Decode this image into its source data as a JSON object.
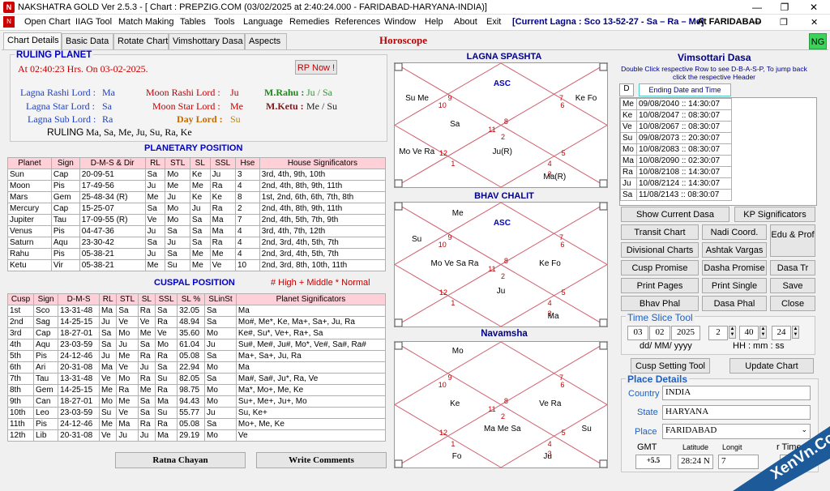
{
  "window": {
    "title": "NAKSHATRA GOLD Ver 2.5.3 - [ Chart : PREPZIG.COM (03/02/2025 at 2:40:24.000 - FARIDABAD-HARYANA-INDIA)]",
    "icon": "NG"
  },
  "menu": {
    "items": [
      "Open Chart",
      "IIAG Tool",
      "Match Making",
      "Tables",
      "Tools",
      "Language",
      "Remedies",
      "References",
      "Window",
      "Help",
      "About",
      "Exit"
    ],
    "lagna_info": "[Current Lagna : Sco 13-52-27 - Sa – Ra – Me]",
    "location_info": "At FARIDABAD"
  },
  "tabs": [
    "Chart Details",
    "Basic Data",
    "Rotate Chart",
    "Vimshottary Dasa",
    "Aspects"
  ],
  "header": {
    "horoscope": "Horoscope",
    "ng_badge": "NG"
  },
  "ruling": {
    "title": "RULING PLANET",
    "time": "At 02:40:23 Hrs. On 03-02-2025.",
    "rp_button": "RP Now !",
    "lagna_rashi_label": "Lagna Rashi Lord :",
    "lagna_rashi_val": "Ma",
    "lagna_star_label": "Lagna Star Lord :",
    "lagna_star_val": "Sa",
    "lagna_sub_label": "Lagna Sub Lord :",
    "lagna_sub_val": "Ra",
    "moon_rashi_label": "Moon Rashi Lord :",
    "moon_rashi_val": "Ju",
    "moon_star_label": "Moon Star Lord :",
    "moon_star_val": "Me",
    "day_lord_label": "Day Lord :",
    "day_lord_val": "Su",
    "mrahu_label": "M.Rahu :",
    "mrahu_val": "Ju / Sa",
    "mketu_label": "M.Ketu :",
    "mketu_val": "Me / Su",
    "ruling_label": "RULING",
    "ruling_val": "Ma, Sa, Me, Ju, Su, Ra, Ke"
  },
  "planetary": {
    "title": "PLANETARY POSITION",
    "headers": [
      "Planet",
      "Sign",
      "D-M-S & Dir",
      "RL",
      "STL",
      "SL",
      "SSL",
      "Hse",
      "House Significators"
    ],
    "rows": [
      [
        "Sun",
        "Cap",
        "20-09-51",
        "Sa",
        "Mo",
        "Ke",
        "Ju",
        "3",
        "3rd, 4th, 9th, 10th"
      ],
      [
        "Moon",
        "Pis",
        "17-49-56",
        "Ju",
        "Me",
        "Me",
        "Ra",
        "4",
        "2nd, 4th, 8th, 9th, 11th"
      ],
      [
        "Mars",
        "Gem",
        "25-48-34  (R)",
        "Me",
        "Ju",
        "Ke",
        "Ke",
        "8",
        "1st, 2nd, 6th, 6th, 7th, 8th"
      ],
      [
        "Mercury",
        "Cap",
        "15-25-07",
        "Sa",
        "Mo",
        "Ju",
        "Ra",
        "2",
        "2nd, 4th, 8th, 9th, 11th"
      ],
      [
        "Jupiter",
        "Tau",
        "17-09-55  (R)",
        "Ve",
        "Mo",
        "Sa",
        "Ma",
        "7",
        "2nd, 4th, 5th, 7th, 9th"
      ],
      [
        "Venus",
        "Pis",
        "04-47-36",
        "Ju",
        "Sa",
        "Sa",
        "Ma",
        "4",
        "3rd, 4th, 7th, 12th"
      ],
      [
        "Saturn",
        "Aqu",
        "23-30-42",
        "Sa",
        "Ju",
        "Sa",
        "Ra",
        "4",
        "2nd, 3rd, 4th, 5th, 7th"
      ],
      [
        "Rahu",
        "Pis",
        "05-38-21",
        "Ju",
        "Sa",
        "Me",
        "Me",
        "4",
        "2nd, 3rd, 4th, 5th, 7th"
      ],
      [
        "Ketu",
        "Vir",
        "05-38-21",
        "Me",
        "Su",
        "Me",
        "Ve",
        "10",
        "2nd, 3rd, 8th, 10th, 11th"
      ]
    ]
  },
  "cuspal": {
    "title": "CUSPAL POSITION",
    "legend": "# High + Middle * Normal",
    "headers": [
      "Cusp",
      "Sign",
      "D-M-S",
      "RL",
      "STL",
      "SL",
      "SSL",
      "SL %",
      "SLinSt",
      "Planet Significators"
    ],
    "rows": [
      [
        "1st",
        "Sco",
        "13-31-48",
        "Ma",
        "Sa",
        "Ra",
        "Sa",
        "32.05",
        "Sa",
        "Ma"
      ],
      [
        "2nd",
        "Sag",
        "14-25-15",
        "Ju",
        "Ve",
        "Ve",
        "Ra",
        "48.94",
        "Sa",
        "Mo#, Me*, Ke, Ma+, Sa+, Ju, Ra"
      ],
      [
        "3rd",
        "Cap",
        "18-27-01",
        "Sa",
        "Mo",
        "Me",
        "Ve",
        "35.60",
        "Mo",
        "Ke#, Su*, Ve+, Ra+, Sa"
      ],
      [
        "4th",
        "Aqu",
        "23-03-59",
        "Sa",
        "Ju",
        "Sa",
        "Mo",
        "61.04",
        "Ju",
        "Su#, Me#, Ju#, Mo*, Ve#, Sa#, Ra#"
      ],
      [
        "5th",
        "Pis",
        "24-12-46",
        "Ju",
        "Me",
        "Ra",
        "Ra",
        "05.08",
        "Sa",
        "Ma+, Sa+, Ju, Ra"
      ],
      [
        "6th",
        "Ari",
        "20-31-08",
        "Ma",
        "Ve",
        "Ju",
        "Sa",
        "22.94",
        "Mo",
        "Ma"
      ],
      [
        "7th",
        "Tau",
        "13-31-48",
        "Ve",
        "Mo",
        "Ra",
        "Su",
        "82.05",
        "Sa",
        "Ma#, Sa#, Ju*, Ra, Ve"
      ],
      [
        "8th",
        "Gem",
        "14-25-15",
        "Me",
        "Ra",
        "Me",
        "Ra",
        "98.75",
        "Mo",
        "Ma*, Mo+, Me, Ke"
      ],
      [
        "9th",
        "Can",
        "18-27-01",
        "Mo",
        "Me",
        "Sa",
        "Ma",
        "94.43",
        "Mo",
        "Su+, Me+, Ju+, Mo"
      ],
      [
        "10th",
        "Leo",
        "23-03-59",
        "Su",
        "Ve",
        "Sa",
        "Su",
        "55.77",
        "Ju",
        "Su, Ke+"
      ],
      [
        "11th",
        "Pis",
        "24-12-46",
        "Me",
        "Ma",
        "Ra",
        "Ra",
        "05.08",
        "Sa",
        "Mo+, Me, Ke"
      ],
      [
        "12th",
        "Lib",
        "20-31-08",
        "Ve",
        "Ju",
        "Ju",
        "Ma",
        "29.19",
        "Mo",
        "Ve"
      ]
    ]
  },
  "bottom_buttons": {
    "ratna": "Ratna Chayan",
    "write": "Write Comments"
  },
  "charts": {
    "lagna": {
      "title": "LAGNA SPASHTA",
      "asc": "ASC",
      "numbers": [
        "9",
        "10",
        "8",
        "11",
        "2",
        "12",
        "1",
        "7",
        "6",
        "5",
        "4",
        "3"
      ],
      "texts": [
        "Su Me",
        "Sa",
        "Ke Fo",
        "Mo Ve Ra",
        "Ju(R)",
        "Ma(R)"
      ]
    },
    "bhav": {
      "title": "BHAV CHALIT",
      "asc": "ASC",
      "numbers": [
        "9",
        "10",
        "8",
        "11",
        "2",
        "12",
        "1",
        "7",
        "6",
        "5",
        "4",
        "3"
      ],
      "texts": [
        "Me",
        "Su",
        "Mo Ve Sa Ra",
        "Ke Fo",
        "Ju",
        "Ma"
      ]
    },
    "navamsha": {
      "title": "Navamsha",
      "numbers": [
        "9",
        "10",
        "8",
        "11",
        "2",
        "12",
        "1",
        "7",
        "6",
        "5",
        "4",
        "3"
      ],
      "texts": [
        "Mo",
        "Ke",
        "Ve Ra",
        "Ma Me Sa",
        "Su",
        "Fo",
        "Ju"
      ]
    }
  },
  "vimsottari": {
    "title": "Vimsottari Dasa",
    "instruction": "Double Click respective Row to see D-B-A-S-P, To jump back click the respective Header",
    "col_d": "D",
    "col_end": "Ending Date and Time",
    "rows": [
      [
        "Me",
        "09/08/2040 :: 14:30:07"
      ],
      [
        "Ke",
        "10/08/2047 :: 08:30:07"
      ],
      [
        "Ve",
        "10/08/2067 :: 08:30:07"
      ],
      [
        "Su",
        "09/08/2073 :: 20:30:07"
      ],
      [
        "Mo",
        "10/08/2083 :: 08:30:07"
      ],
      [
        "Ma",
        "10/08/2090 :: 02:30:07"
      ],
      [
        "Ra",
        "10/08/2108 :: 14:30:07"
      ],
      [
        "Ju",
        "10/08/2124 :: 14:30:07"
      ],
      [
        "Sa",
        "11/08/2143 :: 08:30:07"
      ]
    ]
  },
  "right_buttons": {
    "show_dasa": "Show Current Dasa",
    "kp_sig": "KP Significators",
    "transit": "Transit Chart",
    "nadi": "Nadi Coord.",
    "edu_prof": "Edu & Prof",
    "divisional": "Divisional Charts",
    "ashtak": "Ashtak Vargas",
    "cusp_promise": "Cusp Promise",
    "dasha_promise": "Dasha Promise",
    "dasa_tr": "Dasa Tr",
    "print_pages": "Print Pages",
    "print_single": "Print Single",
    "save": "Save",
    "bhav_phal": "Bhav Phal",
    "dasa_phal": "Dasa Phal",
    "close": "Close"
  },
  "time_slice": {
    "title": "Time Slice Tool",
    "dd": "03",
    "mm": "02",
    "yyyy": "2025",
    "date_fmt": "dd/ MM/ yyyy",
    "hh": "2",
    "min": "40",
    "ss": "24",
    "time_fmt": "HH : mm : ss",
    "cusp_setting": "Cusp Setting Tool",
    "update_chart": "Update Chart"
  },
  "place": {
    "title": "Place Details",
    "country_label": "Country",
    "country_val": "INDIA",
    "state_label": "State",
    "state_val": "HARYANA",
    "place_label": "Place",
    "place_val": "FARIDABAD",
    "gmt_label": "GMT",
    "gmt_val": "+5.5",
    "lat_label": "Latitude",
    "lat_val": "28:24 N",
    "long_label": "Longit",
    "long_val": "7",
    "time_label": "r Time",
    "time_val": "00:00"
  },
  "watermark": {
    "text": "XenVn.Com",
    "color": "#1c5a9a"
  }
}
